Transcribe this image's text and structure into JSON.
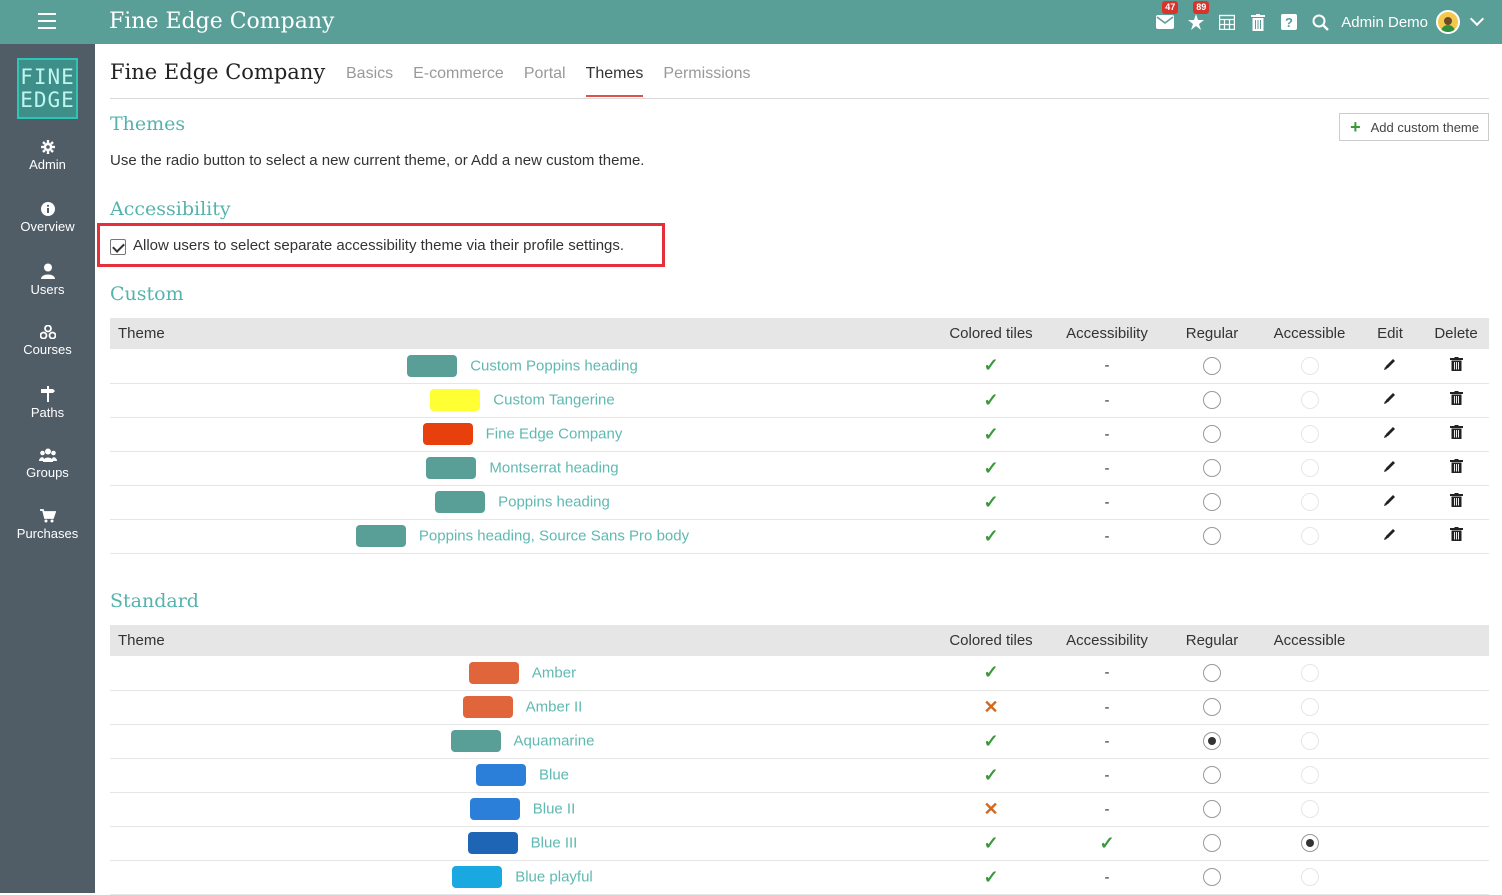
{
  "app": {
    "title": "Fine Edge Company",
    "user_name": "Admin Demo"
  },
  "notifications": {
    "mail_count": "47",
    "alerts_count": "89"
  },
  "brand": {
    "logo_line1": "FINE",
    "logo_line2": "EDGE",
    "topbar_color": "#5a9e98",
    "sidebar_color": "#505c66",
    "accent": "#55b3ae"
  },
  "sidebar": {
    "items": [
      {
        "label": "Admin",
        "icon": "gear-icon"
      },
      {
        "label": "Overview",
        "icon": "info-icon"
      },
      {
        "label": "Users",
        "icon": "user-icon"
      },
      {
        "label": "Courses",
        "icon": "courses-icon"
      },
      {
        "label": "Paths",
        "icon": "signpost-icon"
      },
      {
        "label": "Groups",
        "icon": "group-icon"
      },
      {
        "label": "Purchases",
        "icon": "cart-icon"
      }
    ]
  },
  "page": {
    "title": "Fine Edge Company",
    "tabs": [
      {
        "label": "Basics",
        "active": false
      },
      {
        "label": "E-commerce",
        "active": false
      },
      {
        "label": "Portal",
        "active": false
      },
      {
        "label": "Themes",
        "active": true
      },
      {
        "label": "Permissions",
        "active": false
      }
    ]
  },
  "themes_section": {
    "title": "Themes",
    "description": "Use the radio button to select a new current theme, or Add a new custom theme.",
    "add_button": "Add custom theme"
  },
  "accessibility": {
    "title": "Accessibility",
    "checkbox_label": "Allow users to select separate accessibility theme via their profile settings.",
    "checked": true
  },
  "custom": {
    "title": "Custom",
    "columns": [
      "Theme",
      "Colored tiles",
      "Accessibility",
      "Regular",
      "Accessible",
      "Edit",
      "Delete"
    ],
    "rows": [
      {
        "name": "Custom Poppins heading",
        "color": "#5a9e98",
        "colored_tiles": true,
        "accessibility": "-",
        "regular": false,
        "accessible": false
      },
      {
        "name": "Custom Tangerine",
        "color": "#ffff33",
        "colored_tiles": true,
        "accessibility": "-",
        "regular": false,
        "accessible": false
      },
      {
        "name": "Fine Edge Company",
        "color": "#e8400c",
        "colored_tiles": true,
        "accessibility": "-",
        "regular": false,
        "accessible": false
      },
      {
        "name": "Montserrat heading",
        "color": "#5a9e98",
        "colored_tiles": true,
        "accessibility": "-",
        "regular": false,
        "accessible": false
      },
      {
        "name": "Poppins heading",
        "color": "#5a9e98",
        "colored_tiles": true,
        "accessibility": "-",
        "regular": false,
        "accessible": false
      },
      {
        "name": "Poppins heading, Source Sans Pro body",
        "color": "#5a9e98",
        "colored_tiles": true,
        "accessibility": "-",
        "regular": false,
        "accessible": false
      }
    ]
  },
  "standard": {
    "title": "Standard",
    "columns": [
      "Theme",
      "Colored tiles",
      "Accessibility",
      "Regular",
      "Accessible"
    ],
    "rows": [
      {
        "name": "Amber",
        "color": "#e0653a",
        "colored_tiles": true,
        "accessibility": "-",
        "regular": false,
        "accessible": false
      },
      {
        "name": "Amber II",
        "color": "#e0653a",
        "colored_tiles": false,
        "accessibility": "-",
        "regular": false,
        "accessible": false
      },
      {
        "name": "Aquamarine",
        "color": "#5a9e98",
        "colored_tiles": true,
        "accessibility": "-",
        "regular": true,
        "accessible": false
      },
      {
        "name": "Blue",
        "color": "#2b7fd8",
        "colored_tiles": true,
        "accessibility": "-",
        "regular": false,
        "accessible": false
      },
      {
        "name": "Blue II",
        "color": "#2b7fd8",
        "colored_tiles": false,
        "accessibility": "-",
        "regular": false,
        "accessible": false
      },
      {
        "name": "Blue III",
        "color": "#1f65b5",
        "colored_tiles": true,
        "accessibility": "check",
        "regular": false,
        "accessible": true
      },
      {
        "name": "Blue playful",
        "color": "#19a9e0",
        "colored_tiles": true,
        "accessibility": "-",
        "regular": false,
        "accessible": false
      }
    ]
  }
}
